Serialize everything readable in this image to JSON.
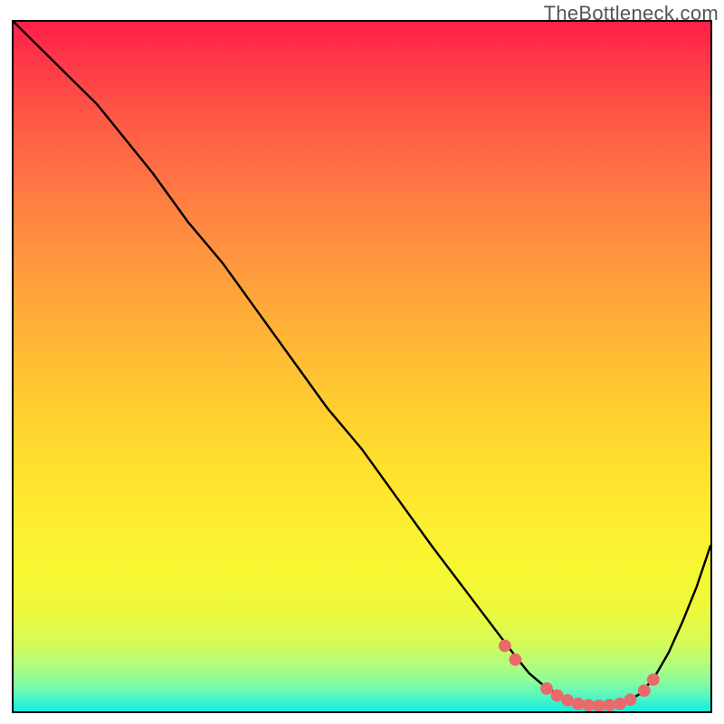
{
  "watermark": "TheBottleneck.com",
  "chart_data": {
    "type": "line",
    "title": "",
    "xlabel": "",
    "ylabel": "",
    "categories_implicit": "x represents normalized position 0–100, y represents bottleneck percentage 0–100 (100 = top)",
    "xlim": [
      0,
      100
    ],
    "ylim": [
      0,
      100
    ],
    "series": [
      {
        "name": "bottleneck-curve",
        "x": [
          0,
          3,
          6,
          9,
          12,
          16,
          20,
          25,
          30,
          35,
          40,
          45,
          50,
          55,
          60,
          63,
          66,
          69,
          72,
          74,
          76,
          78,
          80,
          82,
          84,
          86,
          88,
          90,
          92,
          94,
          96,
          98,
          100
        ],
        "y": [
          100,
          97,
          94,
          91,
          88,
          83,
          78,
          71,
          65,
          58,
          51,
          44,
          38,
          31,
          24,
          20,
          16,
          12,
          8,
          5.5,
          3.8,
          2.5,
          1.5,
          1,
          0.8,
          0.9,
          1.4,
          2.6,
          5,
          8.5,
          13,
          18,
          24
        ]
      }
    ],
    "markers": [
      {
        "x": 70.5,
        "y": 9.5
      },
      {
        "x": 72.0,
        "y": 7.5
      },
      {
        "x": 76.5,
        "y": 3.3
      },
      {
        "x": 78.0,
        "y": 2.3
      },
      {
        "x": 79.5,
        "y": 1.6
      },
      {
        "x": 81.0,
        "y": 1.1
      },
      {
        "x": 82.5,
        "y": 0.9
      },
      {
        "x": 84.0,
        "y": 0.8
      },
      {
        "x": 85.5,
        "y": 0.9
      },
      {
        "x": 87.0,
        "y": 1.1
      },
      {
        "x": 88.5,
        "y": 1.7
      },
      {
        "x": 90.5,
        "y": 3.0
      },
      {
        "x": 91.8,
        "y": 4.6
      }
    ],
    "colors": {
      "curve_stroke": "#000000",
      "marker_fill": "#e96a6a",
      "frame_border": "#000000",
      "watermark_text": "#555555"
    },
    "background_gradient_stops": [
      {
        "pct": 0,
        "color": "#ff1f4a"
      },
      {
        "pct": 15,
        "color": "#ff5c46"
      },
      {
        "pct": 40,
        "color": "#ffa63a"
      },
      {
        "pct": 62,
        "color": "#ffdb2e"
      },
      {
        "pct": 80,
        "color": "#f7f732"
      },
      {
        "pct": 93,
        "color": "#b6fc78"
      },
      {
        "pct": 100,
        "color": "#18eddd"
      }
    ]
  }
}
